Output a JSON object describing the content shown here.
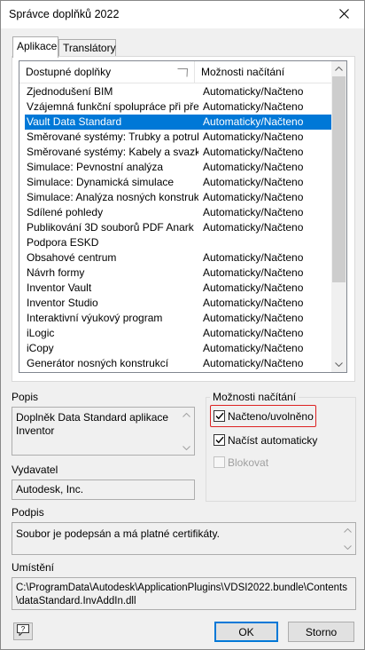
{
  "window": {
    "title": "Správce doplňků 2022"
  },
  "tabs": [
    {
      "label": "Aplikace",
      "active": true
    },
    {
      "label": "Translátory",
      "active": false
    }
  ],
  "list": {
    "columns": [
      "Dostupné doplňky",
      "Možnosti načítání"
    ],
    "rows": [
      {
        "name": "Zjednodušení BIM",
        "load": "Automaticky/Načteno"
      },
      {
        "name": "Vzájemná funkční spolupráce při přet...",
        "load": "Automaticky/Načteno"
      },
      {
        "name": "Vault Data Standard",
        "load": "Automaticky/Načteno",
        "selected": true
      },
      {
        "name": "Směrované systémy: Trubky a potrubí",
        "load": "Automaticky/Načteno"
      },
      {
        "name": "Směrované systémy: Kabely a svazky",
        "load": "Automaticky/Načteno"
      },
      {
        "name": "Simulace: Pevnostní analýza",
        "load": "Automaticky/Načteno"
      },
      {
        "name": "Simulace: Dynamická simulace",
        "load": "Automaticky/Načteno"
      },
      {
        "name": "Simulace: Analýza nosných konstrukcí",
        "load": "Automaticky/Načteno"
      },
      {
        "name": "Sdílené pohledy",
        "load": "Automaticky/Načteno"
      },
      {
        "name": "Publikování 3D souborů PDF Anark",
        "load": "Automaticky/Načteno"
      },
      {
        "name": "Podpora ESKD",
        "load": ""
      },
      {
        "name": "Obsahové centrum",
        "load": "Automaticky/Načteno"
      },
      {
        "name": "Návrh formy",
        "load": "Automaticky/Načteno"
      },
      {
        "name": "Inventor Vault",
        "load": "Automaticky/Načteno"
      },
      {
        "name": "Inventor Studio",
        "load": "Automaticky/Načteno"
      },
      {
        "name": "Interaktivní výukový program",
        "load": "Automaticky/Načteno"
      },
      {
        "name": "iLogic",
        "load": "Automaticky/Načteno"
      },
      {
        "name": "iCopy",
        "load": "Automaticky/Načteno"
      },
      {
        "name": "Generátor nosných konstrukcí",
        "load": "Automaticky/Načteno"
      }
    ]
  },
  "description": {
    "label": "Popis",
    "text_line1": "Doplněk Data Standard aplikace",
    "text_line2": "Inventor"
  },
  "publisher": {
    "label": "Vydavatel",
    "value": "Autodesk, Inc."
  },
  "load_options": {
    "label": "Možnosti načítání",
    "loaded_unloaded": {
      "label": "Načteno/uvolněno",
      "checked": true
    },
    "load_automatically": {
      "label": "Načíst automaticky",
      "checked": true
    },
    "block": {
      "label": "Blokovat",
      "checked": false,
      "disabled": true
    }
  },
  "signature": {
    "label": "Podpis",
    "text": "Soubor je podepsán a má platné certifikáty."
  },
  "location": {
    "label": "Umístění",
    "line1": "C:\\ProgramData\\Autodesk\\ApplicationPlugins\\VDSI2022.bundle\\Contents",
    "line2": "\\dataStandard.InvAddIn.dll"
  },
  "buttons": {
    "ok": "OK",
    "cancel": "Storno",
    "help": "?"
  },
  "colors": {
    "selection": "#0078d7",
    "highlight_border": "#dd2222"
  }
}
